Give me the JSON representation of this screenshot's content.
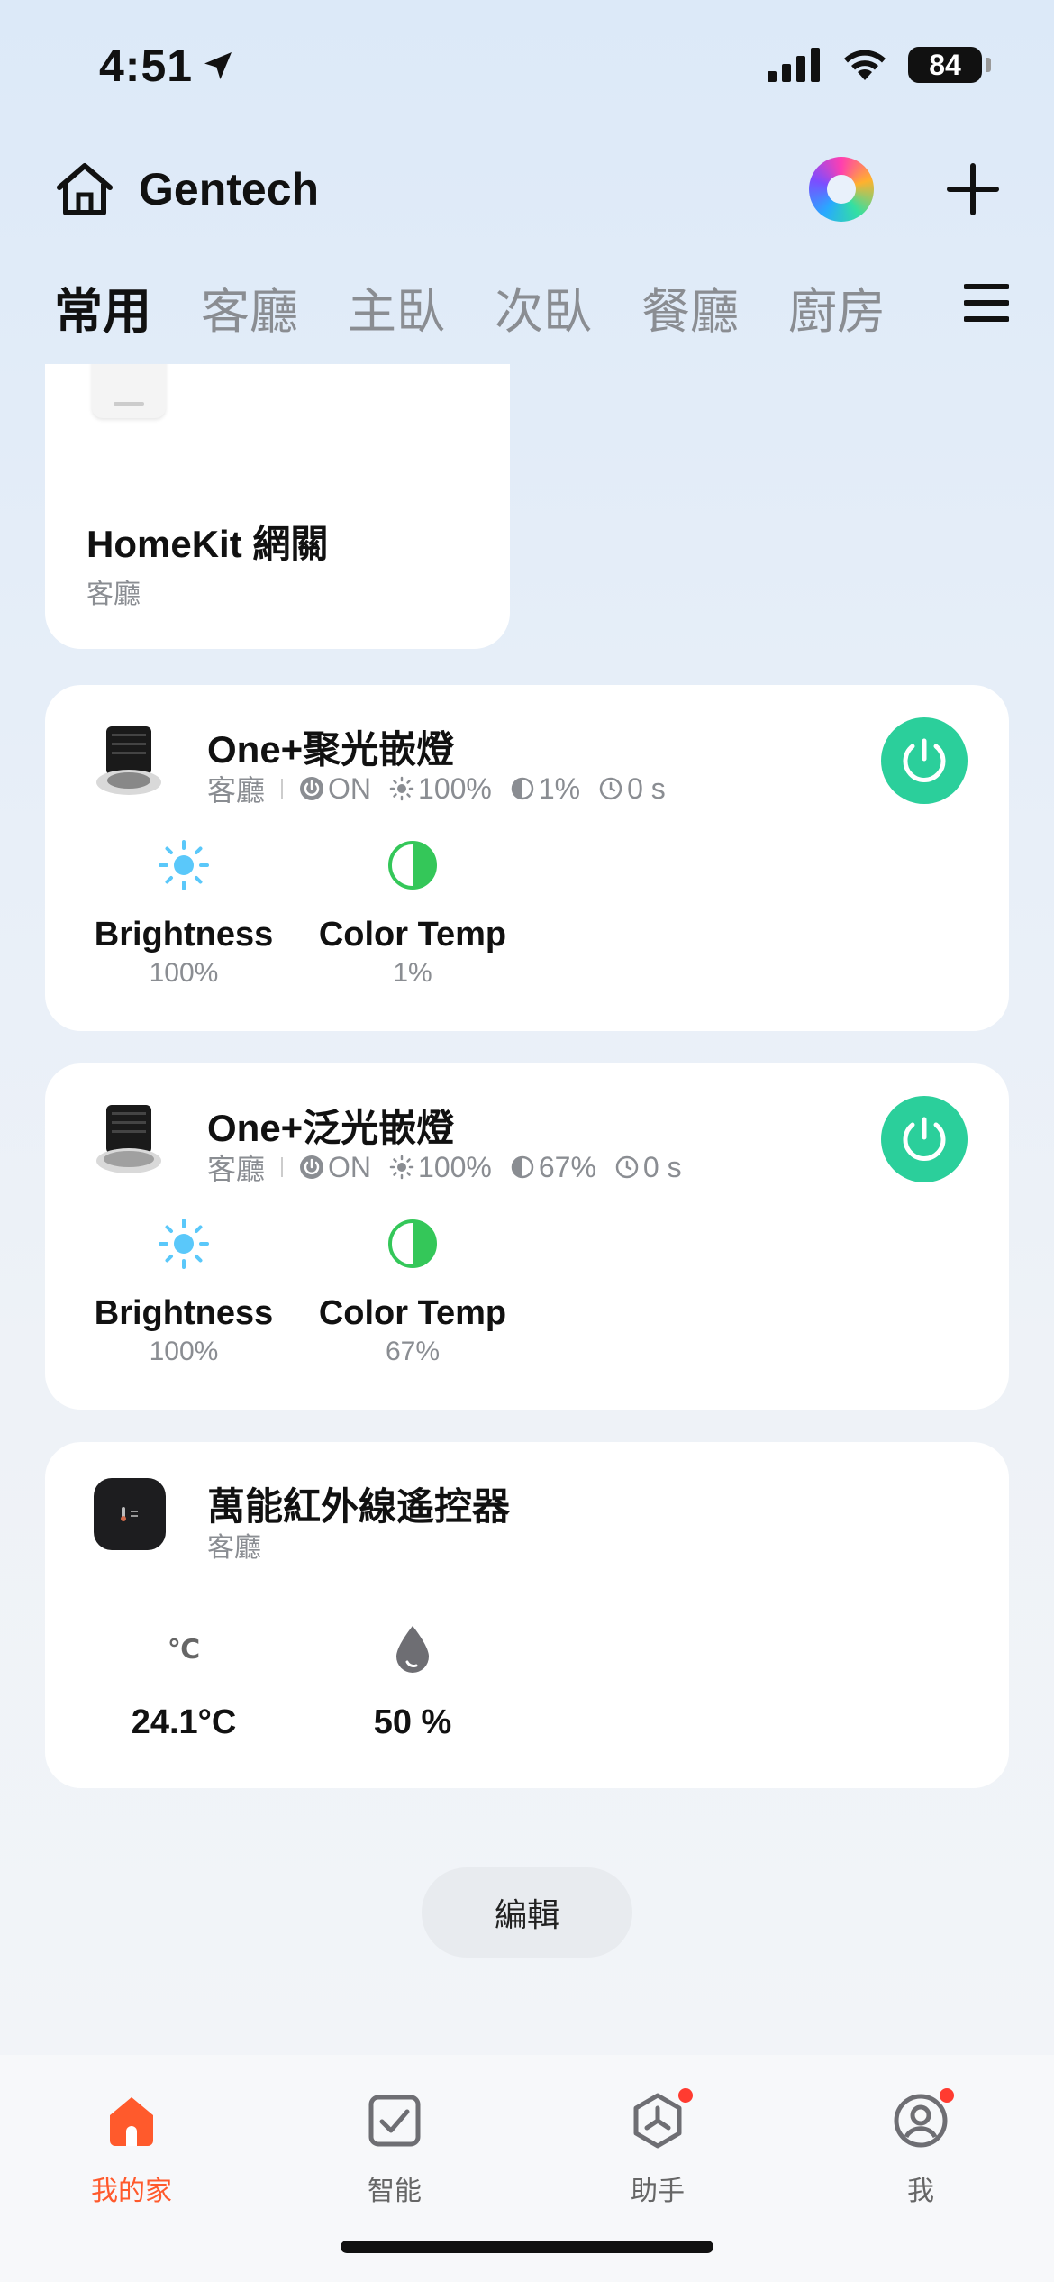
{
  "status_bar": {
    "time": "4:51",
    "battery": "84"
  },
  "header": {
    "title": "Gentech"
  },
  "tabs": [
    {
      "label": "常用",
      "active": true
    },
    {
      "label": "客廳",
      "active": false
    },
    {
      "label": "主臥",
      "active": false
    },
    {
      "label": "次臥",
      "active": false
    },
    {
      "label": "餐廳",
      "active": false
    },
    {
      "label": "廚房",
      "active": false
    }
  ],
  "devices": {
    "gateway": {
      "name": "HomeKit 網關",
      "room": "客廳"
    },
    "spot_light": {
      "name": "One+聚光嵌燈",
      "room": "客廳",
      "status": {
        "power": "ON",
        "brightness": "100%",
        "color_temp": "1%",
        "timer": "0 s"
      },
      "brightness_label": "Brightness",
      "brightness_value": "100%",
      "color_temp_label": "Color Temp",
      "color_temp_value": "1%"
    },
    "flood_light": {
      "name": "One+泛光嵌燈",
      "room": "客廳",
      "status": {
        "power": "ON",
        "brightness": "100%",
        "color_temp": "67%",
        "timer": "0 s"
      },
      "brightness_label": "Brightness",
      "brightness_value": "100%",
      "color_temp_label": "Color Temp",
      "color_temp_value": "67%"
    },
    "ir_remote": {
      "name": "萬能紅外線遙控器",
      "room": "客廳",
      "temp_unit": "℃",
      "temperature": "24.1°C",
      "humidity": "50 %"
    }
  },
  "edit_button": "編輯",
  "bottom_nav": [
    {
      "label": "我的家",
      "active": true
    },
    {
      "label": "智能",
      "active": false
    },
    {
      "label": "助手",
      "active": false
    },
    {
      "label": "我",
      "active": false
    }
  ],
  "colors": {
    "accent": "#ff5a2c",
    "power_on": "#2bcf9b",
    "brightness": "#5ac8fa",
    "color_temp": "#34c759"
  }
}
